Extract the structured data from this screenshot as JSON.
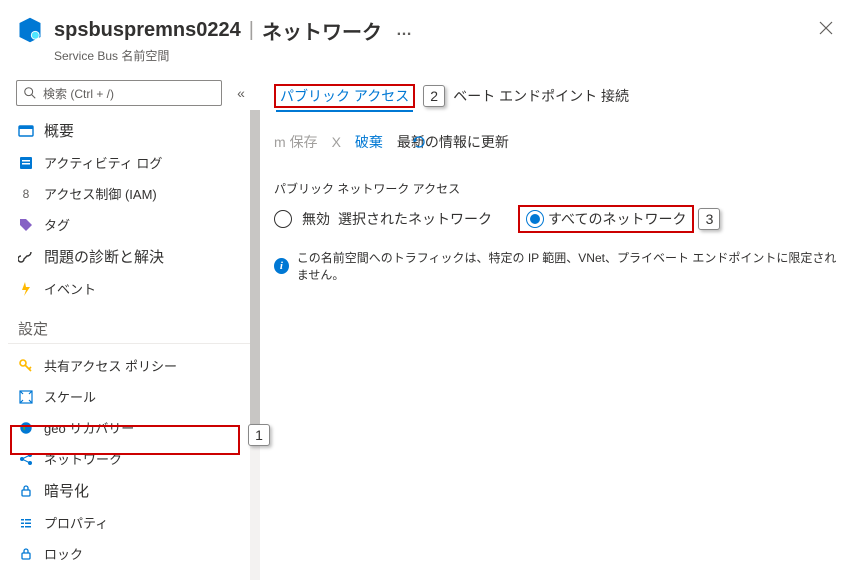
{
  "header": {
    "title_resource": "spsbuspremns0224",
    "title_page": "ネットワーク",
    "subtitle": "Service Bus 名前空間",
    "more": "…"
  },
  "search": {
    "placeholder": "検索 (Ctrl + /)"
  },
  "sidebar": {
    "items": [
      {
        "label": "概要",
        "icon": "overview"
      },
      {
        "label": "アクティビティ ログ",
        "icon": "activity"
      },
      {
        "label": "アクセス制御 (IAM)",
        "icon": "iam"
      },
      {
        "label": "タグ",
        "icon": "tag"
      },
      {
        "label": "問題の診断と解決",
        "icon": "diagnose"
      },
      {
        "label": "イベント",
        "icon": "events"
      }
    ],
    "settings_header": "設定",
    "settings": [
      {
        "label": "共有アクセス ポリシー",
        "icon": "key"
      },
      {
        "label": "スケール",
        "icon": "scale"
      },
      {
        "label": "geo リカバリー",
        "icon": "geo"
      },
      {
        "label": "ネットワーク",
        "icon": "network",
        "selected": true
      },
      {
        "label": "暗号化",
        "icon": "lock"
      },
      {
        "label": "プロパティ",
        "icon": "props"
      },
      {
        "label": "ロック",
        "icon": "locklist"
      }
    ]
  },
  "callouts": {
    "c1": "1",
    "c2": "2",
    "c3": "3"
  },
  "main": {
    "tabs": {
      "public": "パブリック アクセス",
      "private": "ベート エンドポイント 接続"
    },
    "toolbar": {
      "save_prefix": "m",
      "save": "保存",
      "x": "X",
      "discard": "破棄",
      "refresh": "最新の情報に更新"
    },
    "field_label": "パブリック ネットワーク アクセス",
    "radios": {
      "disabled": "無効",
      "selected": "選択されたネットワーク",
      "all": "すべてのネットワーク"
    },
    "info_text": "この名前空間へのトラフィックは、特定の IP 範囲、VNet、プライベート エンドポイントに限定されません。"
  }
}
